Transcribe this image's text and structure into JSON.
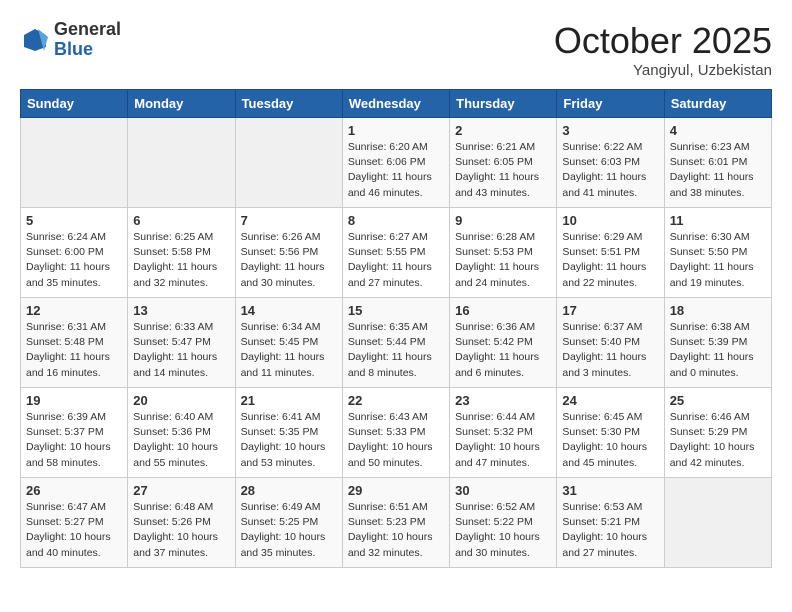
{
  "header": {
    "logo_general": "General",
    "logo_blue": "Blue",
    "month": "October 2025",
    "location": "Yangiyul, Uzbekistan"
  },
  "weekdays": [
    "Sunday",
    "Monday",
    "Tuesday",
    "Wednesday",
    "Thursday",
    "Friday",
    "Saturday"
  ],
  "weeks": [
    [
      {
        "day": "",
        "info": ""
      },
      {
        "day": "",
        "info": ""
      },
      {
        "day": "",
        "info": ""
      },
      {
        "day": "1",
        "info": "Sunrise: 6:20 AM\nSunset: 6:06 PM\nDaylight: 11 hours\nand 46 minutes."
      },
      {
        "day": "2",
        "info": "Sunrise: 6:21 AM\nSunset: 6:05 PM\nDaylight: 11 hours\nand 43 minutes."
      },
      {
        "day": "3",
        "info": "Sunrise: 6:22 AM\nSunset: 6:03 PM\nDaylight: 11 hours\nand 41 minutes."
      },
      {
        "day": "4",
        "info": "Sunrise: 6:23 AM\nSunset: 6:01 PM\nDaylight: 11 hours\nand 38 minutes."
      }
    ],
    [
      {
        "day": "5",
        "info": "Sunrise: 6:24 AM\nSunset: 6:00 PM\nDaylight: 11 hours\nand 35 minutes."
      },
      {
        "day": "6",
        "info": "Sunrise: 6:25 AM\nSunset: 5:58 PM\nDaylight: 11 hours\nand 32 minutes."
      },
      {
        "day": "7",
        "info": "Sunrise: 6:26 AM\nSunset: 5:56 PM\nDaylight: 11 hours\nand 30 minutes."
      },
      {
        "day": "8",
        "info": "Sunrise: 6:27 AM\nSunset: 5:55 PM\nDaylight: 11 hours\nand 27 minutes."
      },
      {
        "day": "9",
        "info": "Sunrise: 6:28 AM\nSunset: 5:53 PM\nDaylight: 11 hours\nand 24 minutes."
      },
      {
        "day": "10",
        "info": "Sunrise: 6:29 AM\nSunset: 5:51 PM\nDaylight: 11 hours\nand 22 minutes."
      },
      {
        "day": "11",
        "info": "Sunrise: 6:30 AM\nSunset: 5:50 PM\nDaylight: 11 hours\nand 19 minutes."
      }
    ],
    [
      {
        "day": "12",
        "info": "Sunrise: 6:31 AM\nSunset: 5:48 PM\nDaylight: 11 hours\nand 16 minutes."
      },
      {
        "day": "13",
        "info": "Sunrise: 6:33 AM\nSunset: 5:47 PM\nDaylight: 11 hours\nand 14 minutes."
      },
      {
        "day": "14",
        "info": "Sunrise: 6:34 AM\nSunset: 5:45 PM\nDaylight: 11 hours\nand 11 minutes."
      },
      {
        "day": "15",
        "info": "Sunrise: 6:35 AM\nSunset: 5:44 PM\nDaylight: 11 hours\nand 8 minutes."
      },
      {
        "day": "16",
        "info": "Sunrise: 6:36 AM\nSunset: 5:42 PM\nDaylight: 11 hours\nand 6 minutes."
      },
      {
        "day": "17",
        "info": "Sunrise: 6:37 AM\nSunset: 5:40 PM\nDaylight: 11 hours\nand 3 minutes."
      },
      {
        "day": "18",
        "info": "Sunrise: 6:38 AM\nSunset: 5:39 PM\nDaylight: 11 hours\nand 0 minutes."
      }
    ],
    [
      {
        "day": "19",
        "info": "Sunrise: 6:39 AM\nSunset: 5:37 PM\nDaylight: 10 hours\nand 58 minutes."
      },
      {
        "day": "20",
        "info": "Sunrise: 6:40 AM\nSunset: 5:36 PM\nDaylight: 10 hours\nand 55 minutes."
      },
      {
        "day": "21",
        "info": "Sunrise: 6:41 AM\nSunset: 5:35 PM\nDaylight: 10 hours\nand 53 minutes."
      },
      {
        "day": "22",
        "info": "Sunrise: 6:43 AM\nSunset: 5:33 PM\nDaylight: 10 hours\nand 50 minutes."
      },
      {
        "day": "23",
        "info": "Sunrise: 6:44 AM\nSunset: 5:32 PM\nDaylight: 10 hours\nand 47 minutes."
      },
      {
        "day": "24",
        "info": "Sunrise: 6:45 AM\nSunset: 5:30 PM\nDaylight: 10 hours\nand 45 minutes."
      },
      {
        "day": "25",
        "info": "Sunrise: 6:46 AM\nSunset: 5:29 PM\nDaylight: 10 hours\nand 42 minutes."
      }
    ],
    [
      {
        "day": "26",
        "info": "Sunrise: 6:47 AM\nSunset: 5:27 PM\nDaylight: 10 hours\nand 40 minutes."
      },
      {
        "day": "27",
        "info": "Sunrise: 6:48 AM\nSunset: 5:26 PM\nDaylight: 10 hours\nand 37 minutes."
      },
      {
        "day": "28",
        "info": "Sunrise: 6:49 AM\nSunset: 5:25 PM\nDaylight: 10 hours\nand 35 minutes."
      },
      {
        "day": "29",
        "info": "Sunrise: 6:51 AM\nSunset: 5:23 PM\nDaylight: 10 hours\nand 32 minutes."
      },
      {
        "day": "30",
        "info": "Sunrise: 6:52 AM\nSunset: 5:22 PM\nDaylight: 10 hours\nand 30 minutes."
      },
      {
        "day": "31",
        "info": "Sunrise: 6:53 AM\nSunset: 5:21 PM\nDaylight: 10 hours\nand 27 minutes."
      },
      {
        "day": "",
        "info": ""
      }
    ]
  ]
}
